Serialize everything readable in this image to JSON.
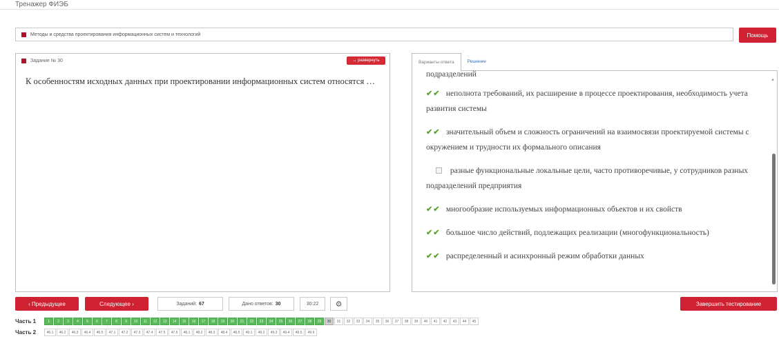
{
  "app": {
    "title": "Тренажер ФИЭБ"
  },
  "subject": {
    "label": "Методы и средства проектирования информационных систем и технологий"
  },
  "header": {
    "help_label": "Помощь"
  },
  "task": {
    "title": "Задание № 30",
    "expand_label": "↔ развернуть",
    "question": "К особенностям исходных данных при проектировании информационных систем относятся …"
  },
  "answers_panel": {
    "tabs": [
      {
        "label": "Варианты ответа",
        "active": true
      },
      {
        "label": "Решение",
        "active": false
      }
    ],
    "cut_off_text": "подразделений",
    "options": [
      {
        "text": "неполнота требований, их расширение в процессе проектирования, необходимость учета развития системы",
        "correct": true,
        "checked": true
      },
      {
        "text": "значительный объем и сложность ограничений на взаимосвязи проектируемой системы с окружением и трудности их формального описания",
        "correct": true,
        "checked": true
      },
      {
        "text": "разные функциональные локальные цели, часто противоречивые, у сотрудников разных подразделений предприятия",
        "correct": false,
        "checked": false
      },
      {
        "text": "многообразие используемых информационных объектов и их свойств",
        "correct": true,
        "checked": true
      },
      {
        "text": "большое число действий, подлежащих реализации (многофункциональность)",
        "correct": true,
        "checked": true
      },
      {
        "text": "распределенный и асинхронный режим обработки данных",
        "correct": true,
        "checked": true
      }
    ]
  },
  "footer": {
    "prev_label": "‹ Предыдущее",
    "next_label": "Следующее ›",
    "tasks_label": "Заданий:",
    "tasks_value": "67",
    "answered_label": "Дано ответов:",
    "answered_value": "30",
    "timer": "30:22",
    "gear_icon": "gear-icon",
    "finish_label": "Завершить тестирование"
  },
  "parts": [
    {
      "label": "Часть 1",
      "cells": [
        "1",
        "2",
        "3",
        "4",
        "5",
        "6",
        "7",
        "8",
        "9",
        "10",
        "11",
        "12",
        "13",
        "14",
        "15",
        "16",
        "17",
        "18",
        "19",
        "20",
        "21",
        "22",
        "23",
        "24",
        "25",
        "26",
        "27",
        "28",
        "29",
        "30",
        "31",
        "32",
        "33",
        "34",
        "35",
        "36",
        "37",
        "38",
        "39",
        "40",
        "41",
        "42",
        "43",
        "44",
        "45"
      ],
      "done_count": 29,
      "current": "30"
    },
    {
      "label": "Часть 2",
      "cells": [
        "46.1",
        "46.2",
        "46.3",
        "46.4",
        "46.5",
        "47.1",
        "47.2",
        "47.3",
        "47.4",
        "47.5",
        "47.6",
        "48.1",
        "48.2",
        "48.3",
        "48.4",
        "48.5",
        "49.1",
        "49.2",
        "49.3",
        "49.4",
        "49.5",
        "49.6"
      ],
      "done_count": 0,
      "current": ""
    }
  ],
  "colors": {
    "accent_red": "#cf2131",
    "done_green": "#5cb85c",
    "check_green": "#59a52b"
  }
}
